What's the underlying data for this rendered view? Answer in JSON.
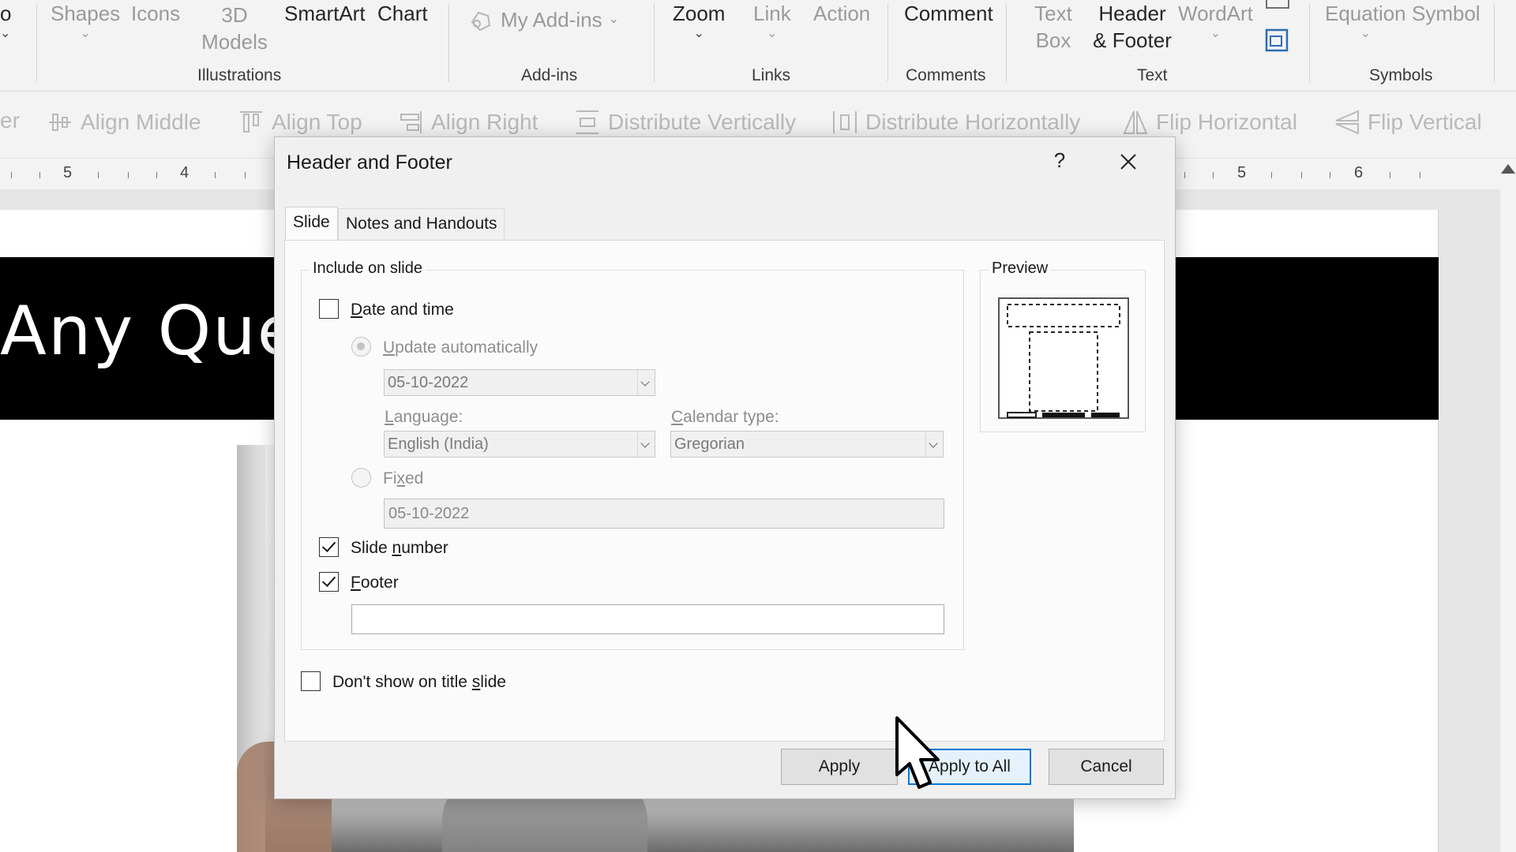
{
  "ribbon": {
    "partial_left": "o",
    "shapes": "Shapes",
    "icons": "Icons",
    "models_3d": "3D Models",
    "smartart": "SmartArt",
    "chart": "Chart",
    "my_addins": "My Add-ins",
    "zoom": "Zoom",
    "link": "Link",
    "action": "Action",
    "comment": "Comment",
    "text_box": "Text Box",
    "header_footer": "Header & Footer",
    "wordart": "WordArt",
    "equation": "Equation",
    "symbol": "Symbol",
    "groups": {
      "illustrations": "Illustrations",
      "addins": "Add-ins",
      "links": "Links",
      "comments": "Comments",
      "text": "Text",
      "symbols": "Symbols"
    }
  },
  "arrange": {
    "partial": "er",
    "align_middle": "Align Middle",
    "align_top": "Align Top",
    "align_right": "Align Right",
    "distribute_vertically": "Distribute Vertically",
    "distribute_horizontally": "Distribute Horizontally",
    "flip_horizontal": "Flip Horizontal",
    "flip_vertical": "Flip Vertical"
  },
  "ruler": {
    "left_labels": [
      "5",
      "4"
    ],
    "right_labels": [
      "5",
      "6"
    ]
  },
  "slide": {
    "title_visible": "Any Ques"
  },
  "dialog": {
    "title": "Header and Footer",
    "help": "?",
    "tabs": [
      {
        "label": "Slide",
        "active": true
      },
      {
        "label": "Notes and Handouts",
        "active": false
      }
    ],
    "include_on_slide": "Include on slide",
    "date_and_time": {
      "label_pre": "",
      "label_u": "D",
      "label_post": "ate and time",
      "checked": false
    },
    "update_automatically": {
      "label_u": "U",
      "label_post": "pdate automatically",
      "selected": true
    },
    "auto_date_value": "05-10-2022",
    "language_label_pre": "",
    "language_label_u": "L",
    "language_label_post": "anguage:",
    "language_value": "English (India)",
    "calendar_label_u": "C",
    "calendar_label_post": "alendar type:",
    "calendar_value": "Gregorian",
    "fixed": {
      "label_pre": "Fi",
      "label_u": "x",
      "label_post": "ed",
      "selected": false
    },
    "fixed_value": "05-10-2022",
    "slide_number": {
      "label_pre": "Slide ",
      "label_u": "n",
      "label_post": "umber",
      "checked": true
    },
    "footer": {
      "label_u": "F",
      "label_post": "ooter",
      "checked": true
    },
    "footer_value": "",
    "dont_show_title": {
      "label_pre": "Don't show on title ",
      "label_u": "s",
      "label_post": "lide",
      "checked": false
    },
    "preview_label": "Preview",
    "buttons": {
      "apply": "Apply",
      "apply_to_all": "Apply to All",
      "cancel": "Cancel"
    }
  },
  "colors": {
    "accent": "#0078d7",
    "dialog_bg": "#f0f0f0",
    "disabled_text": "#8d8d8d"
  }
}
